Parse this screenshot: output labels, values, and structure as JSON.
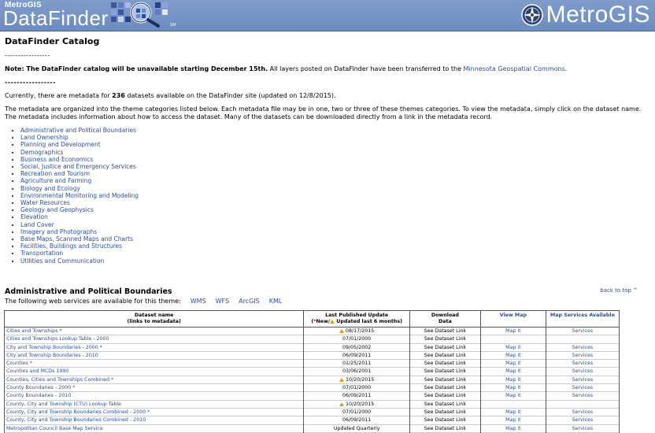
{
  "header": {
    "logo_small": "MetroGIS",
    "logo_big": "DataFinder",
    "sm": "SM",
    "brand": "MetroGIS"
  },
  "page": {
    "title": "DataFinder Catalog",
    "rule": "-----------------",
    "note_bold": "Note: The DataFinder catalog will be unavailable starting December 15th.",
    "note_text": " All layers posted on DataFinder have been transferred to the ",
    "note_link": "Minnesota Geospatial Commons.",
    "count_pre": "Currently, there are metadata for ",
    "count": "236",
    "count_post": " datasets available on the DataFinder site (updated on 12/8/2015).",
    "intro": "The metadata are organized into the theme categories listed below. Each metadata file may be in one, two or three of these themes categories. To view the metadata, simply click on the dataset name. The metadata includes information about how to access the dataset. Many of the datasets can be downloaded directly from a link in the metadata record."
  },
  "themes": [
    "Administrative and Political Boundaries",
    "Land Ownership",
    "Planning and Development",
    "Demographics",
    "Business and Economics",
    "Social, Justice and Emergency Services",
    "Recreation and Tourism",
    "Agriculture and Farming",
    "Biology and Ecology",
    "Environmental Monitoring and Modeling",
    "Water Resources",
    "Geology and Geophysics",
    "Elevation",
    "Land Cover",
    "Imagery and Photographs",
    "Base Maps, Scanned Maps and Charts",
    "Facilities, Buildings and Structures",
    "Transportation",
    "Utilities and Communication"
  ],
  "section": {
    "title": "Administrative and Political Boundaries",
    "back_to_top": "back to top ^",
    "services_text": "The following web services are available for this theme:",
    "services": [
      "WMS",
      "WFS",
      "ArcGIS",
      "KML"
    ]
  },
  "table": {
    "headers": {
      "name_line1": "Dataset name",
      "name_line2": "(links to metadata)",
      "update_line1": "Last Published Update",
      "update_star": "*",
      "update_new": "New/",
      "update_recent": "Updated last 6 months)",
      "update_open": "(",
      "download_line1": "Download",
      "download_line2": "Data",
      "view_map": "View Map",
      "map_services": "Map Services Available"
    },
    "rows": [
      {
        "name": "Cities and Townships *",
        "date": "08/17/2015",
        "recent": true,
        "download": "See Dataset Link",
        "map": "Map it",
        "services": "Services"
      },
      {
        "name": "Cities and Townships Lookup Table - 2000",
        "date": "07/01/2000",
        "recent": false,
        "download": "See Dataset Link",
        "map": "",
        "services": ""
      },
      {
        "name": "City and Township Boundaries - 2000 *",
        "date": "09/05/2002",
        "recent": false,
        "download": "See Dataset Link",
        "map": "Map it",
        "services": "Services"
      },
      {
        "name": "City and Township Boundaries - 2010",
        "date": "06/09/2011",
        "recent": false,
        "download": "See Dataset Link",
        "map": "Map it",
        "services": "Services"
      },
      {
        "name": "Counties *",
        "date": "01/25/2011",
        "recent": false,
        "download": "See Dataset Link",
        "map": "Map it",
        "services": "Services"
      },
      {
        "name": "Counties and MCDs 1990",
        "date": "03/06/2001",
        "recent": false,
        "download": "See Dataset Link",
        "map": "Map it",
        "services": "Services"
      },
      {
        "name": "Counties, Cities and Townships Combined *",
        "date": "10/20/2015",
        "recent": true,
        "download": "See Dataset Link",
        "map": "Map it",
        "services": "Services"
      },
      {
        "name": "County Boundaries - 2000 *",
        "date": "07/01/2000",
        "recent": false,
        "download": "See Dataset Link",
        "map": "Map it",
        "services": "Services"
      },
      {
        "name": "County Boundaries - 2010",
        "date": "06/09/2011",
        "recent": false,
        "download": "See Dataset Link",
        "map": "Map it",
        "services": "Services"
      },
      {
        "name": "County, City and Township (CTU) Lookup Table",
        "date": "10/20/2015",
        "recent": true,
        "download": "See Dataset Link",
        "map": "",
        "services": ""
      },
      {
        "name": "County, City and Township Boundaries Combined - 2000 *",
        "date": "07/01/2000",
        "recent": false,
        "download": "See Dataset Link",
        "map": "Map it",
        "services": "Services"
      },
      {
        "name": "County, City and Township Boundaries Combined - 2010",
        "date": "06/09/2011",
        "recent": false,
        "download": "See Dataset Link",
        "map": "Map it",
        "services": "Services"
      },
      {
        "name": "Metropolitan Council Base Map Service",
        "date": "Updated Quarterly",
        "recent": false,
        "download": "See Dataset Link",
        "map": "Map it",
        "services": "Services"
      }
    ]
  },
  "colors": {
    "banner": "#7f9ccb",
    "link": "#2a4f9a",
    "recent_marker": "#e49a12",
    "new_marker": "#c00000"
  }
}
